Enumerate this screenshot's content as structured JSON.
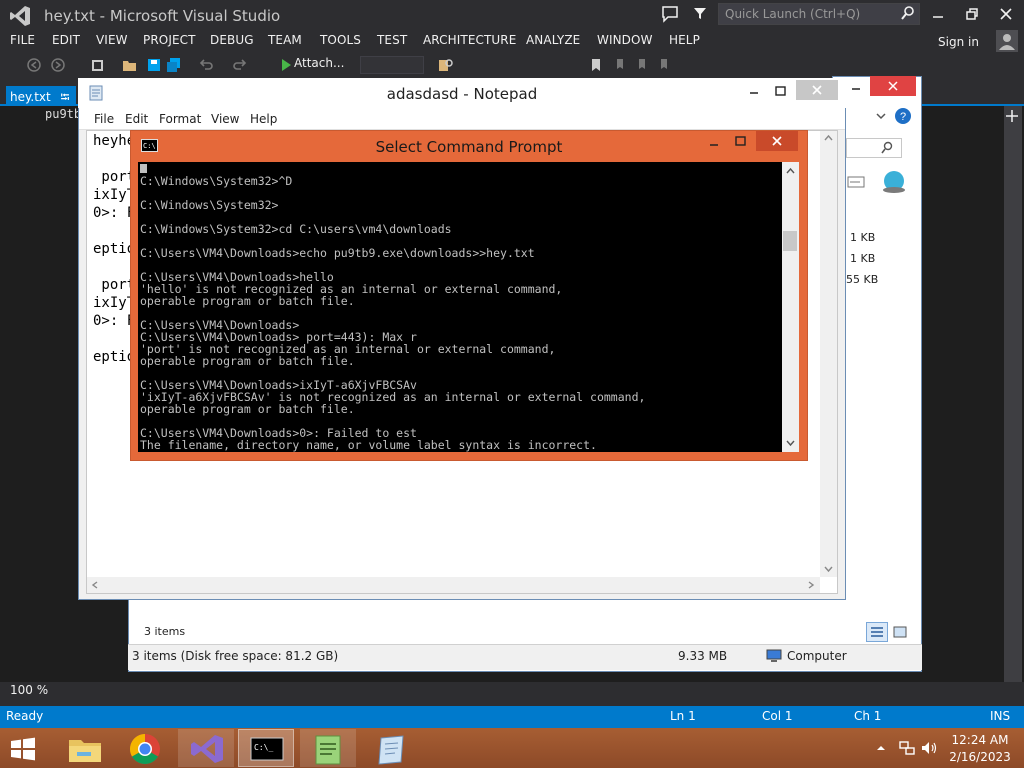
{
  "vs": {
    "title": "hey.txt - Microsoft Visual Studio",
    "quick_launch_placeholder": "Quick Launch (Ctrl+Q)",
    "menu": [
      "FILE",
      "EDIT",
      "VIEW",
      "PROJECT",
      "DEBUG",
      "TEAM",
      "TOOLS",
      "TEST",
      "ARCHITECTURE",
      "ANALYZE",
      "WINDOW",
      "HELP"
    ],
    "sign_in": "Sign in",
    "attach_label": "Attach...",
    "tab_label": "hey.txt",
    "editor_text": "pu9tb",
    "zoom": "100 %",
    "status": {
      "ready": "Ready",
      "ln": "Ln 1",
      "col": "Col 1",
      "ch": "Ch 1",
      "ins": "INS"
    }
  },
  "explorer": {
    "sizes": [
      "1 KB",
      "1 KB",
      "55 KB"
    ],
    "item_count": "3 items",
    "status_left": "3 items (Disk free space: 81.2 GB)",
    "status_size": "9.33 MB",
    "status_location": "Computer"
  },
  "notepad": {
    "title": "adasdasd - Notepad",
    "menu": [
      "File",
      "Edit",
      "Format",
      "View",
      "Help"
    ],
    "lines": [
      "heyhe",
      " port",
      "ixIyT",
      "0>: F",
      "eptio",
      " port",
      "ixIyT",
      "0>: F",
      "eptio"
    ]
  },
  "cmd": {
    "title": "Select Command Prompt",
    "lines": [
      "C:\\Windows\\System32>^D",
      "",
      "C:\\Windows\\System32>",
      "",
      "C:\\Windows\\System32>cd C:\\users\\vm4\\downloads",
      "",
      "C:\\Users\\VM4\\Downloads>echo pu9tb9.exe\\downloads>>hey.txt",
      "",
      "C:\\Users\\VM4\\Downloads>hello",
      "'hello' is not recognized as an internal or external command,",
      "operable program or batch file.",
      "",
      "C:\\Users\\VM4\\Downloads>",
      "C:\\Users\\VM4\\Downloads> port=443): Max r",
      "'port' is not recognized as an internal or external command,",
      "operable program or batch file.",
      "",
      "C:\\Users\\VM4\\Downloads>ixIyT-a6XjvFBCSAv",
      "'ixIyT-a6XjvFBCSAv' is not recognized as an internal or external command,",
      "operable program or batch file.",
      "",
      "C:\\Users\\VM4\\Downloads>0>: Failed to est",
      "The filename, directory name, or volume label syntax is incorrect."
    ]
  },
  "taskbar": {
    "time": "12:24 AM",
    "date": "2/16/2023"
  },
  "colors": {
    "vs_blue": "#007acc",
    "cmd_title": "#e5693a",
    "taskbar": "#a75e33"
  }
}
